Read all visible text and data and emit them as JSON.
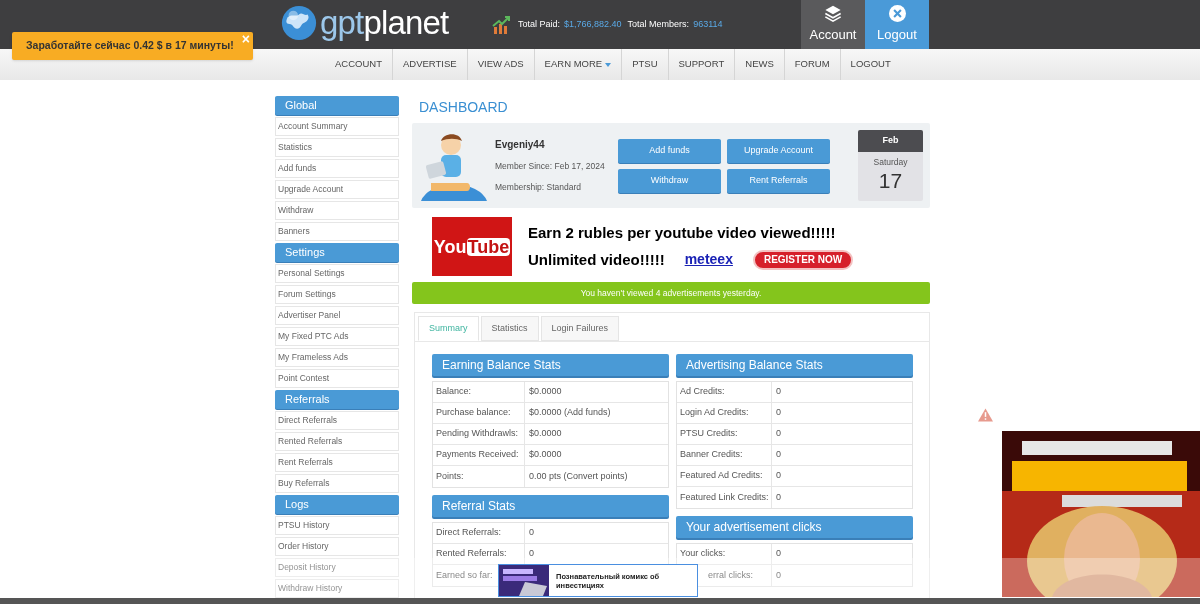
{
  "header": {
    "logo": {
      "part1": "gpt",
      "part2": "planet"
    },
    "stats": [
      {
        "label": "Total Paid:",
        "value": "$1,766,882.40"
      },
      {
        "label": "Total Members:",
        "value": "963114"
      }
    ],
    "buttons": [
      {
        "kind": "account",
        "label": "Account"
      },
      {
        "kind": "logout",
        "label": "Logout"
      }
    ]
  },
  "toast": {
    "text": "Заработайте сейчас 0.42 $ в 17 минуты!",
    "close": "×"
  },
  "nav": [
    {
      "label": "ACCOUNT",
      "dropdown": false
    },
    {
      "label": "ADVERTISE",
      "dropdown": false
    },
    {
      "label": "VIEW ADS",
      "dropdown": false
    },
    {
      "label": "EARN MORE",
      "dropdown": true
    },
    {
      "label": "PTSU",
      "dropdown": false
    },
    {
      "label": "SUPPORT",
      "dropdown": false
    },
    {
      "label": "NEWS",
      "dropdown": false
    },
    {
      "label": "FORUM",
      "dropdown": false
    },
    {
      "label": "LOGOUT",
      "dropdown": false
    }
  ],
  "sidebar": [
    {
      "title": "Global",
      "items": [
        "Account Summary",
        "Statistics",
        "Add funds",
        "Upgrade Account",
        "Withdraw",
        "Banners"
      ]
    },
    {
      "title": "Settings",
      "items": [
        "Personal Settings",
        "Forum Settings",
        "Advertiser Panel",
        "My Fixed PTC Ads",
        "My Frameless Ads",
        "Point Contest"
      ]
    },
    {
      "title": "Referrals",
      "items": [
        "Direct Referrals",
        "Rented Referrals",
        "Rent Referrals",
        "Buy Referrals"
      ]
    },
    {
      "title": "Logs",
      "items": [
        "PTSU History",
        "Order History",
        "Deposit History",
        "Withdraw History"
      ]
    }
  ],
  "dashboard": {
    "title": "DASHBOARD",
    "user": {
      "name": "Evgeniy44",
      "since": "Member Since: Feb 17, 2024",
      "membership": "Membership: Standard"
    },
    "actions": [
      "Add funds",
      "Upgrade Account",
      "Withdraw",
      "Rent Referrals"
    ],
    "date": {
      "month": "Feb",
      "weekday": "Saturday",
      "day": "17"
    }
  },
  "banner": {
    "logo": [
      "You",
      "Tube"
    ],
    "headline": "Earn 2 rubles per youtube video viewed!!!!!",
    "subline": "Unlimited video!!!!!",
    "link": "meteex",
    "button": "REGISTER NOW"
  },
  "notice": "You haven't viewed 4 advertisements yesterday.",
  "tabs": [
    {
      "label": "Summary",
      "selected": true
    },
    {
      "label": "Statistics",
      "selected": false
    },
    {
      "label": "Login Failures",
      "selected": false
    }
  ],
  "left_panels": [
    {
      "title": "Earning Balance Stats",
      "rows": [
        [
          "Balance:",
          "$0.0000"
        ],
        [
          "Purchase balance:",
          "$0.0000 (Add funds)"
        ],
        [
          "Pending Withdrawls:",
          "$0.0000"
        ],
        [
          "Payments Received:",
          "$0.0000"
        ],
        [
          "Points:",
          "0.00 pts (Convert points)"
        ]
      ]
    },
    {
      "title": "Referral Stats",
      "rows": [
        [
          "Direct Referrals:",
          "0"
        ],
        [
          "Rented Referrals:",
          "0"
        ],
        [
          "Earned so far:",
          ""
        ]
      ]
    }
  ],
  "right_panels": [
    {
      "title": "Advertising Balance Stats",
      "rows": [
        [
          "Ad Credits:",
          "0"
        ],
        [
          "Login Ad Credits:",
          "0"
        ],
        [
          "PTSU Credits:",
          "0"
        ],
        [
          "Banner Credits:",
          "0"
        ],
        [
          "Featured Ad Credits:",
          "0"
        ],
        [
          "Featured Link Credits:",
          "0"
        ]
      ]
    },
    {
      "title": "Your advertisement clicks",
      "rows": [
        [
          "Your clicks:",
          "0"
        ],
        [
          "erral clicks:",
          "0"
        ]
      ]
    }
  ],
  "bottom_ad": {
    "text": "Познавательный комикс об инвестициях"
  }
}
